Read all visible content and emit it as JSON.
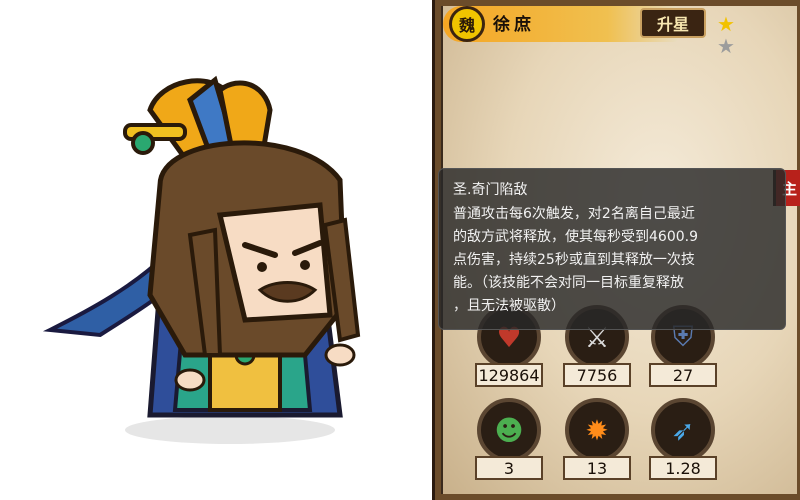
{
  "hero": {
    "faction": "魏",
    "name": "徐庶",
    "upgrade_label": "升星",
    "role_tag": "主"
  },
  "skill": {
    "title": "圣.奇门陷敌",
    "lines": [
      "普通攻击每6次触发，对2名离自己最近",
      "的敌方武将释放，使其每秒受到4600.9",
      "点伤害，持续25秒或直到其释放一次技",
      "能。（该技能不会对同一目标重复释放",
      "，且无法被驱散）"
    ]
  },
  "stats": {
    "hp": "129864",
    "attack": "7756",
    "armor": "27",
    "troops": "3",
    "burst": "13",
    "speed": "1.28"
  },
  "icons": {
    "hp": "heart-icon",
    "attack": "sword-icon",
    "armor": "armor-icon",
    "troops": "people-icon",
    "burst": "explosion-icon",
    "speed": "blade-icon"
  },
  "colors": {
    "header": "#f5a623",
    "gold_star": "#f2c200",
    "grey_star": "#9c9c9c",
    "tag_red": "#b8211b"
  }
}
